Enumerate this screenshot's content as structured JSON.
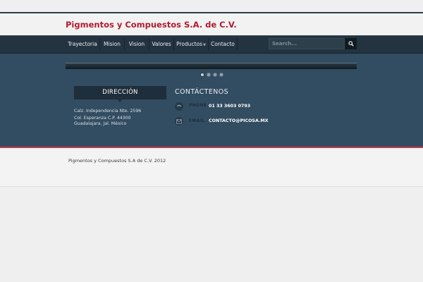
{
  "site": {
    "title": "Pigmentos y Compuestos S.A. de C.V."
  },
  "nav": {
    "items": [
      {
        "label": "Trayectoria"
      },
      {
        "label": "Mision"
      },
      {
        "label": "Vision"
      },
      {
        "label": "Valores"
      },
      {
        "label": "Productos",
        "has_submenu": true
      },
      {
        "label": "Contacto"
      }
    ],
    "search_placeholder": "Search..."
  },
  "slider": {
    "dots": 4,
    "active_index": 0
  },
  "direccion": {
    "heading": "DIRECCIÓN",
    "lines": [
      "Calz. Independencia Nte. 2596",
      "Col. Esperanza C.P. 44300",
      "Guadalajara, Jal. México"
    ]
  },
  "contact": {
    "heading": "CONTÁCTENOS",
    "phone_label": "PHONE",
    "phone_value": "01 33 3603 0793",
    "email_label": "EMAIL",
    "email_value": "CONTACTO@PICOSA.MX"
  },
  "footer": {
    "copyright": "Pigmentos y Compuestos S.A de C.V. 2012"
  },
  "colors": {
    "brand_red": "#b01c30",
    "nav_bg": "#243340",
    "main_bg": "#324c61",
    "accent_line": "#c23a48"
  },
  "icons": {
    "search": "search-icon",
    "phone": "phone-icon",
    "email": "email-icon"
  }
}
